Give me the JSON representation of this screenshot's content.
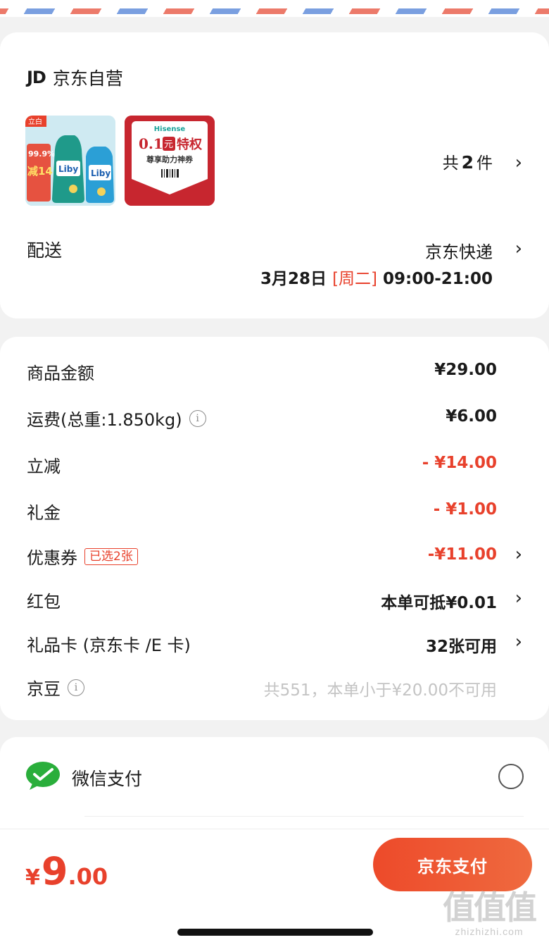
{
  "shop": {
    "logo": "JD",
    "name": "京东自营"
  },
  "products": {
    "thumb1": {
      "badge": "立白",
      "brand": "Liby",
      "promo_top": "99.9%",
      "promo_main": "减14"
    },
    "thumb2": {
      "brand": "Hisense",
      "headline_num": "0.1",
      "headline_unit": "元",
      "headline_tail": "特权",
      "subline": "尊享助力神券"
    },
    "count_prefix": "共",
    "count": "2",
    "count_suffix": "件"
  },
  "delivery": {
    "label": "配送",
    "method": "京东快递",
    "date": "3月28日",
    "weekday": "[周二]",
    "window": "09:00-21:00"
  },
  "summary": {
    "rows": [
      {
        "label": "商品金额",
        "value": "¥29.00"
      },
      {
        "label": "运费(总重:1.850kg)",
        "value": "¥6.00"
      },
      {
        "label": "立减",
        "value": "- ¥14.00"
      },
      {
        "label": "礼金",
        "value": "- ¥1.00"
      },
      {
        "label": "优惠券",
        "tag": "已选2张",
        "value": "-¥11.00"
      },
      {
        "label": "红包",
        "value": "本单可抵¥0.01"
      },
      {
        "label": "礼品卡 (京东卡 /E 卡)",
        "value": "32张可用"
      },
      {
        "label": "京豆",
        "value": "共551，本单小于¥20.00不可用"
      }
    ]
  },
  "payment": {
    "method": "微信支付"
  },
  "footer": {
    "currency": "¥",
    "amount_int": "9",
    "amount_dec": ".00",
    "pay_button": "京东支付"
  },
  "watermark": {
    "glyph": "值值值",
    "site": "zhizhizhi.com"
  },
  "colors": {
    "accent_red": "#e8412c",
    "wechat_green": "#2aae3b",
    "button_gradient_start": "#ed4a2a",
    "button_gradient_end": "#ef6a3f"
  },
  "icons": {
    "chevron": "chevron-right-icon",
    "info": "info-icon",
    "wechat": "wechat-pay-icon",
    "radio": "radio-unchecked"
  }
}
